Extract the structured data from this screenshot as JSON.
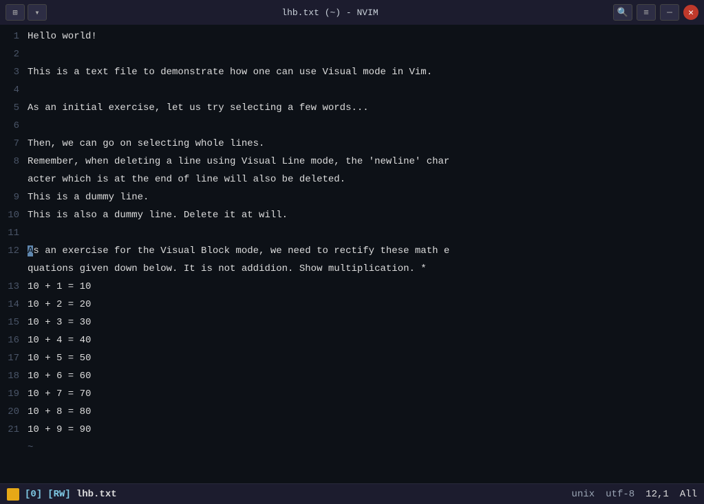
{
  "titlebar": {
    "title": "lhb.txt (~) - NVIM",
    "icon_label": "☰",
    "search_label": "🔍",
    "menu_label": "≡",
    "minimize_label": "─",
    "close_label": "✕"
  },
  "editor": {
    "lines": [
      {
        "num": 1,
        "text": "Hello world!"
      },
      {
        "num": 2,
        "text": ""
      },
      {
        "num": 3,
        "text": "This is a text file to demonstrate how one can use Visual mode in Vim."
      },
      {
        "num": 4,
        "text": ""
      },
      {
        "num": 5,
        "text": "As an initial exercise, let us try selecting a few words..."
      },
      {
        "num": 6,
        "text": ""
      },
      {
        "num": 7,
        "text": "Then, we can go on selecting whole lines."
      },
      {
        "num": 8,
        "text": "Remember, when deleting a line using Visual Line mode, the 'newline' char",
        "continuation": "acter which is at the end of line will also be deleted."
      },
      {
        "num": 9,
        "text": "This is a dummy line."
      },
      {
        "num": 10,
        "text": "This is also a dummy line. Delete it at will."
      },
      {
        "num": 11,
        "text": ""
      },
      {
        "num": 12,
        "text_before_cursor": "",
        "cursor_char": "A",
        "text_after_cursor": "s an exercise for the Visual Block mode, we need to rectify these math e",
        "continuation": "quations given down below. It is not addidion. Show multiplication. *"
      },
      {
        "num": 13,
        "text": "10 + 1 = 10"
      },
      {
        "num": 14,
        "text": "10 + 2 = 20"
      },
      {
        "num": 15,
        "text": "10 + 3 = 30"
      },
      {
        "num": 16,
        "text": "10 + 4 = 40"
      },
      {
        "num": 17,
        "text": "10 + 5 = 50"
      },
      {
        "num": 18,
        "text": "10 + 6 = 60"
      },
      {
        "num": 19,
        "text": "10 + 7 = 70"
      },
      {
        "num": 20,
        "text": "10 + 8 = 80"
      },
      {
        "num": 21,
        "text": "10 + 9 = 90"
      }
    ],
    "tilde_lines": [
      "~"
    ]
  },
  "statusbar": {
    "mode": "[0]",
    "rw": "[RW]",
    "filename": "lhb.txt",
    "file_type": "unix",
    "encoding": "utf-8",
    "position": "12,1",
    "scroll": "All"
  }
}
